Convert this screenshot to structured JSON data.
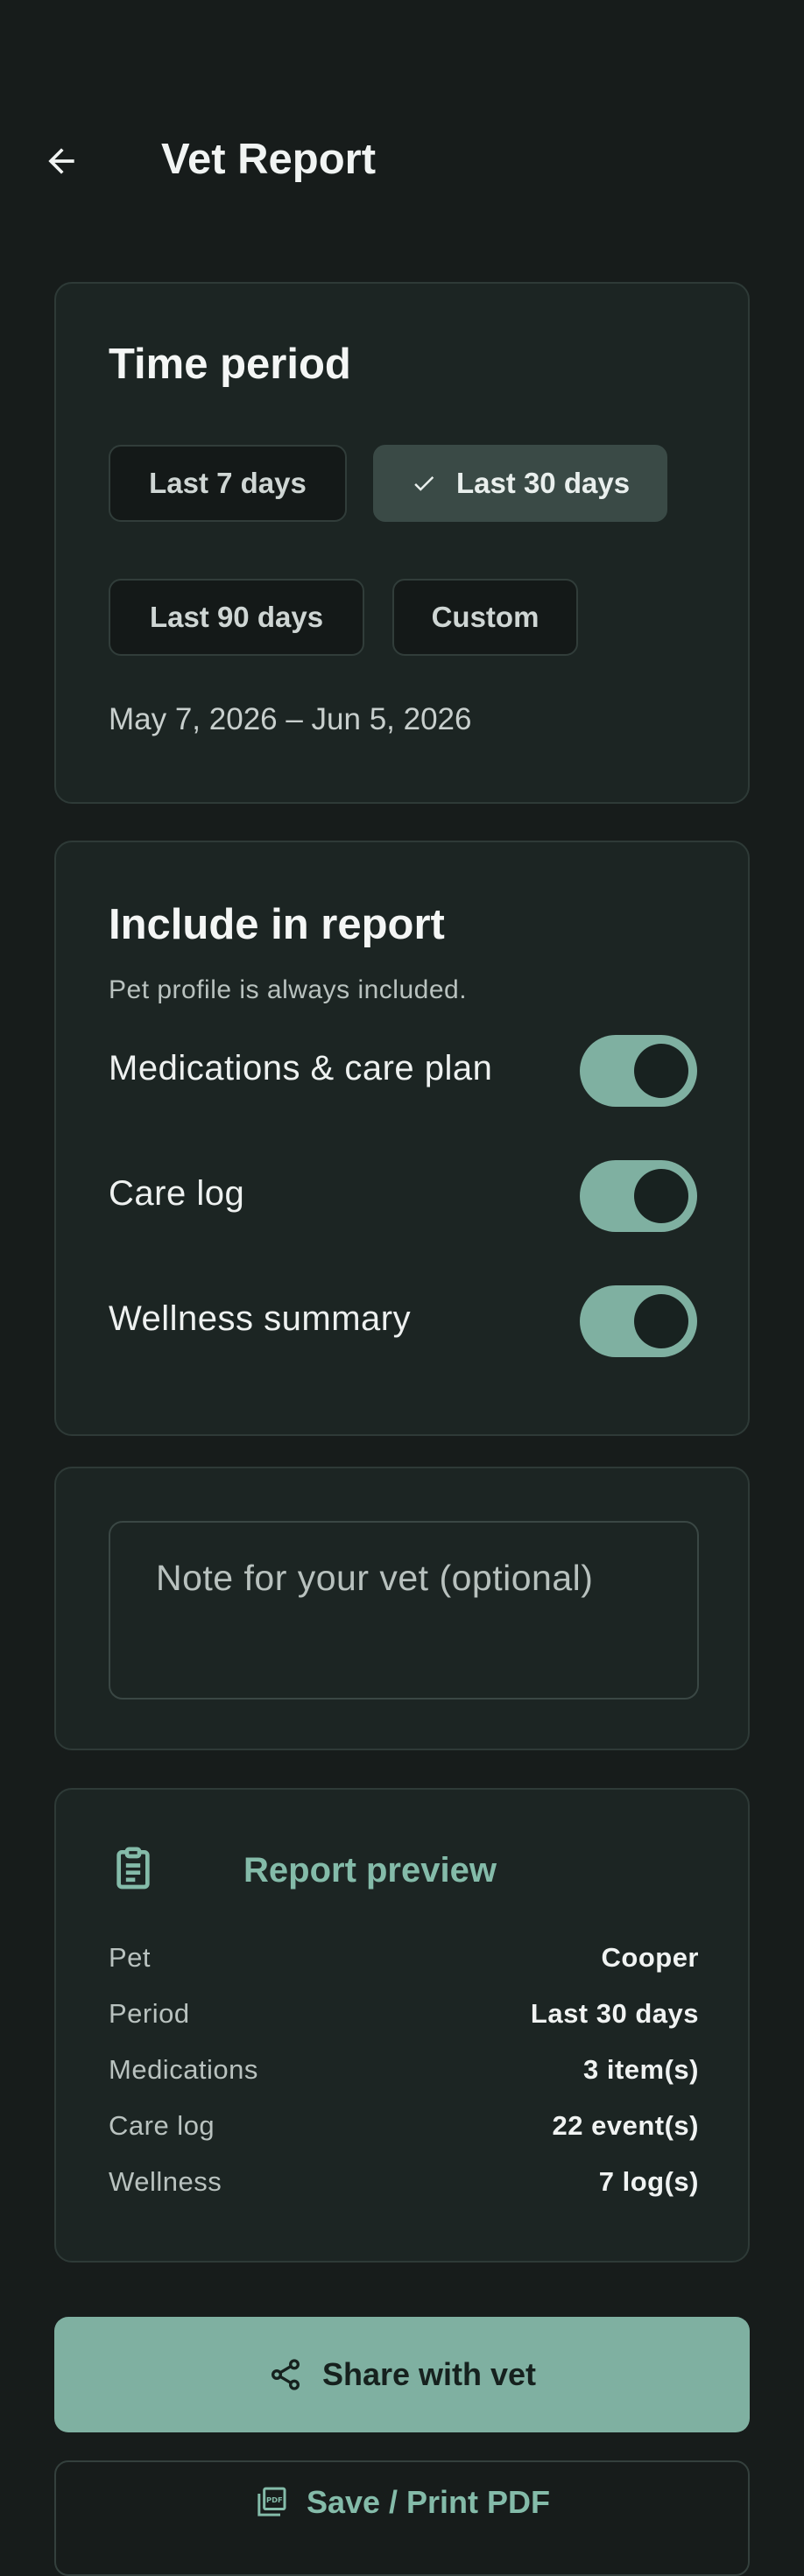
{
  "header": {
    "title": "Vet Report",
    "back_icon": "arrow-left-icon"
  },
  "time_period": {
    "title": "Time period",
    "chips": [
      {
        "label": "Last 7 days",
        "selected": false
      },
      {
        "label": "Last 30 days",
        "selected": true
      },
      {
        "label": "Last 90 days",
        "selected": false
      },
      {
        "label": "Custom",
        "selected": false
      }
    ],
    "range_text": "May 7, 2026 – Jun 5, 2026"
  },
  "include": {
    "title": "Include in report",
    "subtitle": "Pet profile is always included.",
    "toggles": [
      {
        "label": "Medications & care plan",
        "on": true
      },
      {
        "label": "Care log",
        "on": true
      },
      {
        "label": "Wellness summary",
        "on": true
      }
    ]
  },
  "note": {
    "placeholder": "Note for your vet (optional)"
  },
  "preview": {
    "title": "Report preview",
    "icon": "clipboard-icon",
    "rows": [
      {
        "key": "Pet",
        "value": "Cooper"
      },
      {
        "key": "Period",
        "value": "Last 30 days"
      },
      {
        "key": "Medications",
        "value": "3 item(s)"
      },
      {
        "key": "Care log",
        "value": "22 event(s)"
      },
      {
        "key": "Wellness",
        "value": "7 log(s)"
      }
    ]
  },
  "actions": {
    "share_label": "Share with vet",
    "share_icon": "share-icon",
    "save_label": "Save / Print PDF",
    "save_icon": "pdf-icon"
  },
  "colors": {
    "background": "#171c1b",
    "card": "#1c2523",
    "accent": "#7fb0a1",
    "accent_text": "#84bba9"
  }
}
